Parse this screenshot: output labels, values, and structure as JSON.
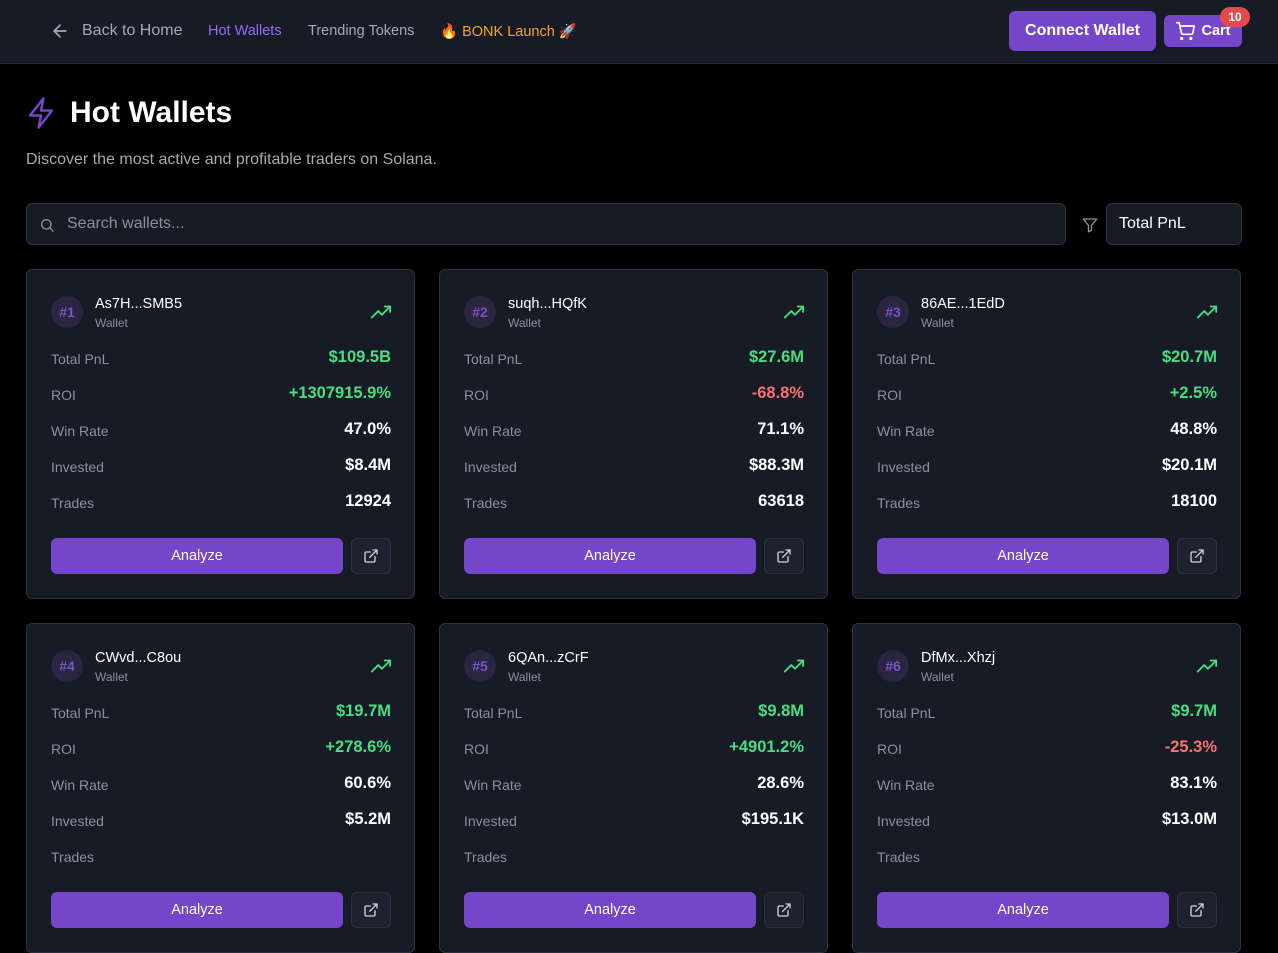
{
  "nav": {
    "back_label": "Back to Home",
    "links": [
      {
        "label": "Hot Wallets",
        "active": true
      },
      {
        "label": "Trending Tokens",
        "active": false
      },
      {
        "label": "🔥 BONK Launch 🚀",
        "active": false
      }
    ],
    "connect_label": "Connect Wallet",
    "cart_label": "Cart",
    "cart_count": "10"
  },
  "header": {
    "title": "Hot Wallets",
    "subtitle": "Discover the most active and profitable traders on Solana."
  },
  "search": {
    "placeholder": "Search wallets...",
    "value": ""
  },
  "sort": {
    "selected": "Total PnL"
  },
  "labels": {
    "wallet": "Wallet",
    "total_pnl": "Total PnL",
    "roi": "ROI",
    "win_rate": "Win Rate",
    "invested": "Invested",
    "trades": "Trades",
    "analyze": "Analyze"
  },
  "colors": {
    "accent": "#7546c9",
    "positive": "#4ade80",
    "negative": "#f87171",
    "bonk": "#f5a524"
  },
  "icons": {
    "back": "arrow-left-icon",
    "cart": "cart-icon",
    "title": "lightning-icon",
    "search": "search-icon",
    "filter": "filter-icon",
    "trend": "trending-up-icon",
    "external": "external-link-icon"
  },
  "wallets": [
    {
      "rank": "#1",
      "address": "As7H...SMB5",
      "total_pnl": "$109.5B",
      "roi": "+1307915.9%",
      "roi_sign": "positive",
      "win_rate": "47.0%",
      "invested": "$8.4M",
      "trades": "12924"
    },
    {
      "rank": "#2",
      "address": "suqh...HQfK",
      "total_pnl": "$27.6M",
      "roi": "-68.8%",
      "roi_sign": "negative",
      "win_rate": "71.1%",
      "invested": "$88.3M",
      "trades": "63618"
    },
    {
      "rank": "#3",
      "address": "86AE...1EdD",
      "total_pnl": "$20.7M",
      "roi": "+2.5%",
      "roi_sign": "positive",
      "win_rate": "48.8%",
      "invested": "$20.1M",
      "trades": "18100"
    },
    {
      "rank": "#4",
      "address": "CWvd...C8ou",
      "total_pnl": "$19.7M",
      "roi": "+278.6%",
      "roi_sign": "positive",
      "win_rate": "60.6%",
      "invested": "$5.2M",
      "trades": ""
    },
    {
      "rank": "#5",
      "address": "6QAn...zCrF",
      "total_pnl": "$9.8M",
      "roi": "+4901.2%",
      "roi_sign": "positive",
      "win_rate": "28.6%",
      "invested": "$195.1K",
      "trades": ""
    },
    {
      "rank": "#6",
      "address": "DfMx...Xhzj",
      "total_pnl": "$9.7M",
      "roi": "-25.3%",
      "roi_sign": "negative",
      "win_rate": "83.1%",
      "invested": "$13.0M",
      "trades": ""
    }
  ]
}
